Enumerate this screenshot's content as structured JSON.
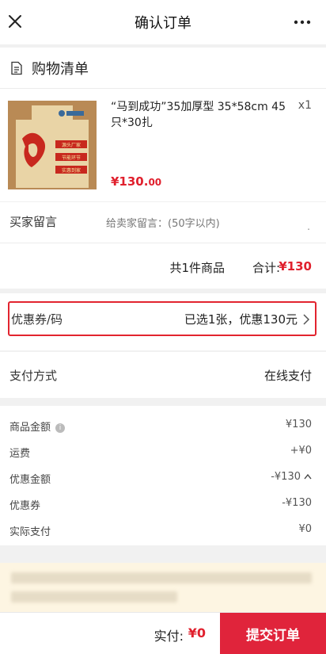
{
  "header": {
    "title": "确认订单",
    "close_icon": "close-icon",
    "more_icon": "more-icon"
  },
  "shopping_list": {
    "label": "购物清单",
    "icon": "document-icon"
  },
  "product": {
    "name": "“马到成功”35加厚型 35*58cm 45只*30扎",
    "quantity": "x1",
    "price_main": "¥130.",
    "price_decimal": "00",
    "thumbnail_text": [
      "源头厂家",
      "节能环节",
      "实惠到家"
    ]
  },
  "message": {
    "label": "买家留言",
    "placeholder": "给卖家留言：(50字以内)",
    "dot": "."
  },
  "summary": {
    "count": "共1件商品",
    "total_label": "合计:",
    "total_value": "¥130"
  },
  "coupon": {
    "label": "优惠券/码",
    "value": "已选1张，优惠130元"
  },
  "payment": {
    "label": "支付方式",
    "value": "在线支付"
  },
  "details": [
    {
      "key": "商品金额",
      "value": "¥130"
    },
    {
      "key": "运费",
      "value": "+¥0"
    },
    {
      "key": "优惠金额",
      "value": "-¥130"
    },
    {
      "key": "优惠券",
      "value": "-¥130"
    },
    {
      "key": "实际支付",
      "value": "¥0"
    }
  ],
  "bottom": {
    "paid_label": "实付:",
    "paid_value": "¥0",
    "submit_label": "提交订单"
  },
  "colors": {
    "accent": "#e0202d",
    "submit": "#e0243b",
    "notice_bg": "#fdf5e2"
  }
}
